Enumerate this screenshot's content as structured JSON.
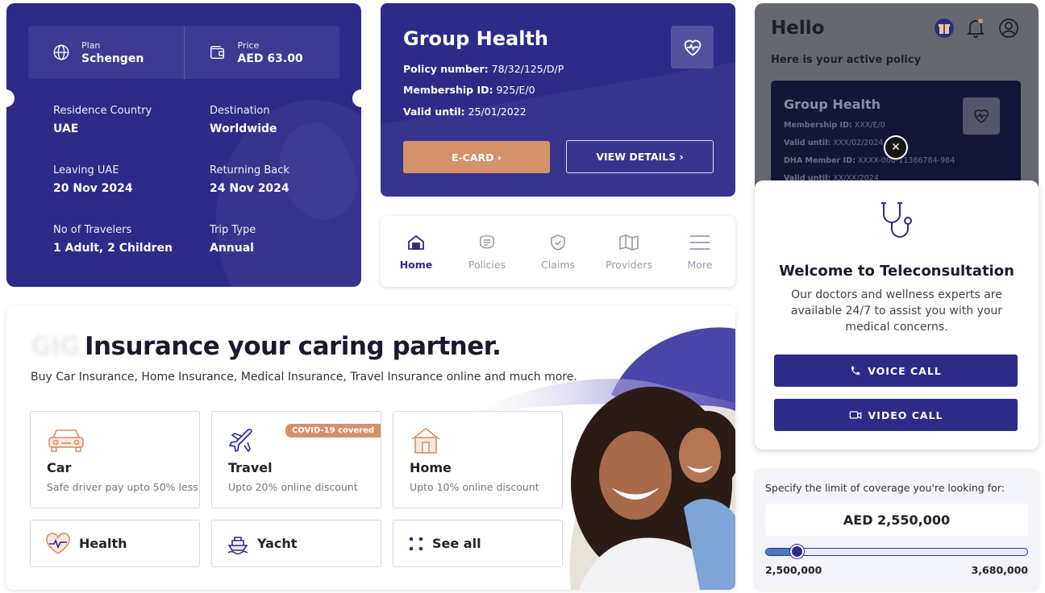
{
  "colors": {
    "brand": "#2e2a88",
    "accent": "#d4916a",
    "muted": "#9a9aaa"
  },
  "travel": {
    "plan_label": "Plan",
    "plan_value": "Schengen",
    "price_label": "Price",
    "price_value": "AED 63.00",
    "fields": [
      {
        "label": "Residence Country",
        "value": "UAE"
      },
      {
        "label": "Destination",
        "value": "Worldwide"
      },
      {
        "label": "Leaving UAE",
        "value": "20 Nov 2024"
      },
      {
        "label": "Returning Back",
        "value": "24 Nov 2024"
      },
      {
        "label": "No of Travelers",
        "value": "1 Adult, 2 Children"
      },
      {
        "label": "Trip Type",
        "value": "Annual"
      }
    ]
  },
  "group_health": {
    "title": "Group Health",
    "policy_label": "Policy number:",
    "policy_value": "78/32/125/D/P",
    "membership_label": "Membership ID:",
    "membership_value": "925/E/0",
    "valid_label": "Valid until:",
    "valid_value": "25/01/2022",
    "ecard_label": "E-CARD ›",
    "details_label": "VIEW DETAILS ›"
  },
  "nav": {
    "items": [
      {
        "label": "Home",
        "icon": "home-icon"
      },
      {
        "label": "Policies",
        "icon": "policies-icon"
      },
      {
        "label": "Claims",
        "icon": "claims-icon"
      },
      {
        "label": "Providers",
        "icon": "map-icon"
      },
      {
        "label": "More",
        "icon": "menu-icon"
      }
    ],
    "active": "Home"
  },
  "hero": {
    "brand": "GIG",
    "title": "Insurance your caring partner.",
    "subtitle": "Buy Car Insurance, Home Insurance, Medical Insurance, Travel Insurance online and much more.",
    "products": [
      {
        "name": "Car",
        "desc": "Safe driver pay upto 50% less",
        "icon": "car-icon"
      },
      {
        "name": "Travel",
        "desc": "Upto 20% online discount",
        "icon": "plane-icon",
        "badge": "COVID-19 covered"
      },
      {
        "name": "Home",
        "desc": "Upto 10% online discount",
        "icon": "house-icon"
      }
    ],
    "small_products": [
      {
        "name": "Health",
        "icon": "heart-icon"
      },
      {
        "name": "Yacht",
        "icon": "yacht-icon"
      },
      {
        "name": "See all",
        "icon": "dots-icon"
      }
    ]
  },
  "hello": {
    "title": "Hello",
    "subtitle": "Here is your active policy",
    "card_title": "Group Health",
    "card_lines": [
      {
        "label": "Membership ID:",
        "value": "XXX/E/0"
      },
      {
        "label": "Valid until:",
        "value": "XXX/02/2024"
      },
      {
        "label": "DHA Member ID:",
        "value": "XXXX-000-11366784-984"
      },
      {
        "label": "Valid until:",
        "value": "XX/XX/2024"
      }
    ],
    "close_glyph": "✕"
  },
  "tele": {
    "title": "Welcome to Teleconsultation",
    "body": "Our doctors and wellness experts are available 24/7  to assist you with your medical concerns.",
    "voice_label": "VOICE CALL",
    "video_label": "VIDEO CALL"
  },
  "coverage": {
    "label": "Specify the limit of coverage you're looking for:",
    "amount": "AED 2,550,000",
    "min": "2,500,000",
    "max": "3,680,000",
    "slider_fraction": 0.043
  }
}
